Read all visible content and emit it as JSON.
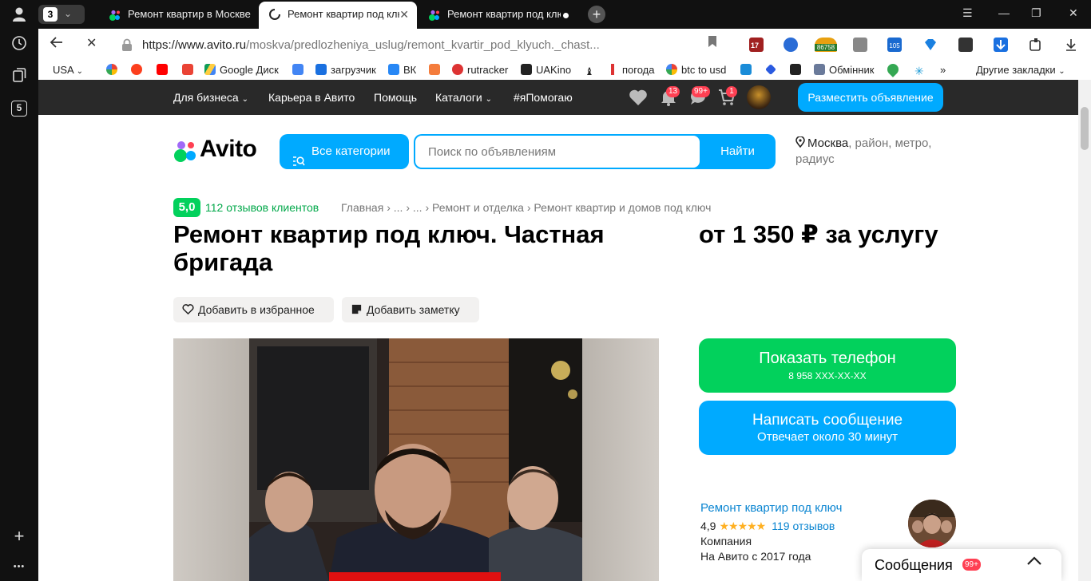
{
  "sidepanel": {
    "items": [
      "profile-icon",
      "history-icon",
      "collections-icon",
      "tab-count"
    ],
    "tab_count_label": "5",
    "add": "+",
    "more": "•••"
  },
  "tabstrip": {
    "tab_count": "3",
    "tabs": [
      {
        "label": "Ремонт квартир в Москве",
        "state": "normal"
      },
      {
        "label": "Ремонт квартир под клю",
        "state": "active-loading"
      },
      {
        "label": "Ремонт квартир под клю",
        "state": "normal"
      }
    ],
    "new_tab": "+"
  },
  "addressbar": {
    "url_domain": "https://www.avito.ru",
    "url_path": "/moskva/predlozheniya_uslug/remont_kvartir_pod_klyuch._chast...",
    "ext_badges": [
      "17",
      "86758",
      "105"
    ]
  },
  "bookmarks": {
    "items": [
      {
        "label": "USA",
        "icon": "flag-icon"
      },
      {
        "label": "",
        "icon": "google-icon"
      },
      {
        "label": "",
        "icon": "yandex-icon"
      },
      {
        "label": "",
        "icon": "youtube-icon"
      },
      {
        "label": "",
        "icon": "gmail-icon"
      },
      {
        "label": "Google Диск",
        "icon": "drive-icon"
      },
      {
        "label": "",
        "icon": "translate-icon"
      },
      {
        "label": "загрузчик",
        "icon": "download-icon"
      },
      {
        "label": "ВК",
        "icon": "vk-icon"
      },
      {
        "label": "",
        "icon": "f-icon"
      },
      {
        "label": "rutracker",
        "icon": "rutracker-icon"
      },
      {
        "label": "UAKino",
        "icon": "uakino-icon"
      },
      {
        "label": "",
        "icon": "chess-icon"
      },
      {
        "label": "погода",
        "icon": "weather-icon"
      },
      {
        "label": "btc to usd",
        "icon": "google-icon"
      },
      {
        "label": "",
        "icon": "p-icon"
      },
      {
        "label": "",
        "icon": "diamond-icon"
      },
      {
        "label": "",
        "icon": "bc-icon"
      },
      {
        "label": "Обмінник",
        "icon": "exchange-icon"
      },
      {
        "label": "",
        "icon": "maps-icon"
      },
      {
        "label": "",
        "icon": "star-icon"
      }
    ],
    "more": "»",
    "other": "Другие закладки"
  },
  "topnav": {
    "links": [
      "Для бизнеса",
      "Карьера в Авито",
      "Помощь",
      "Каталоги",
      "#яПомогаю"
    ],
    "notifications_badge": "13",
    "messages_badge": "99+",
    "cart_badge": "1",
    "post_button": "Разместить объявление"
  },
  "header": {
    "logo": "Avito",
    "all_categories": "Все категории",
    "search_placeholder": "Поиск по объявлениям",
    "search_button": "Найти",
    "location_city": "Москва",
    "location_rest": ", район, метро, радиус"
  },
  "listing": {
    "rating": "5,0",
    "reviews": "112 отзывов клиентов",
    "breadcrumbs": [
      "Главная",
      "...",
      "...",
      "Ремонт и отделка",
      "Ремонт квартир и домов под ключ"
    ],
    "title": "Ремонт квартир под ключ. Частная бригада",
    "price": "от 1 350 ₽ за услугу",
    "add_favorite": "Добавить в избранное",
    "add_note": "Добавить заметку"
  },
  "contact": {
    "show_phone": "Показать телефон",
    "phone_masked": "8 958 XXX-XX-XX",
    "write_message": "Написать сообщение",
    "reply_time": "Отвечает около 30 минут"
  },
  "seller": {
    "name": "Ремонт квартир под ключ",
    "rating": "4,9",
    "stars": "★★★★★",
    "reviews": "119 отзывов",
    "type": "Компания",
    "since": "На Авито с 2017 года"
  },
  "messages_panel": {
    "title": "Сообщения",
    "badge": "99+"
  },
  "colors": {
    "avito_blue": "#00aaff",
    "avito_green": "#02d15c",
    "badge_red": "#ff4053",
    "topnav_bg": "#292929"
  }
}
